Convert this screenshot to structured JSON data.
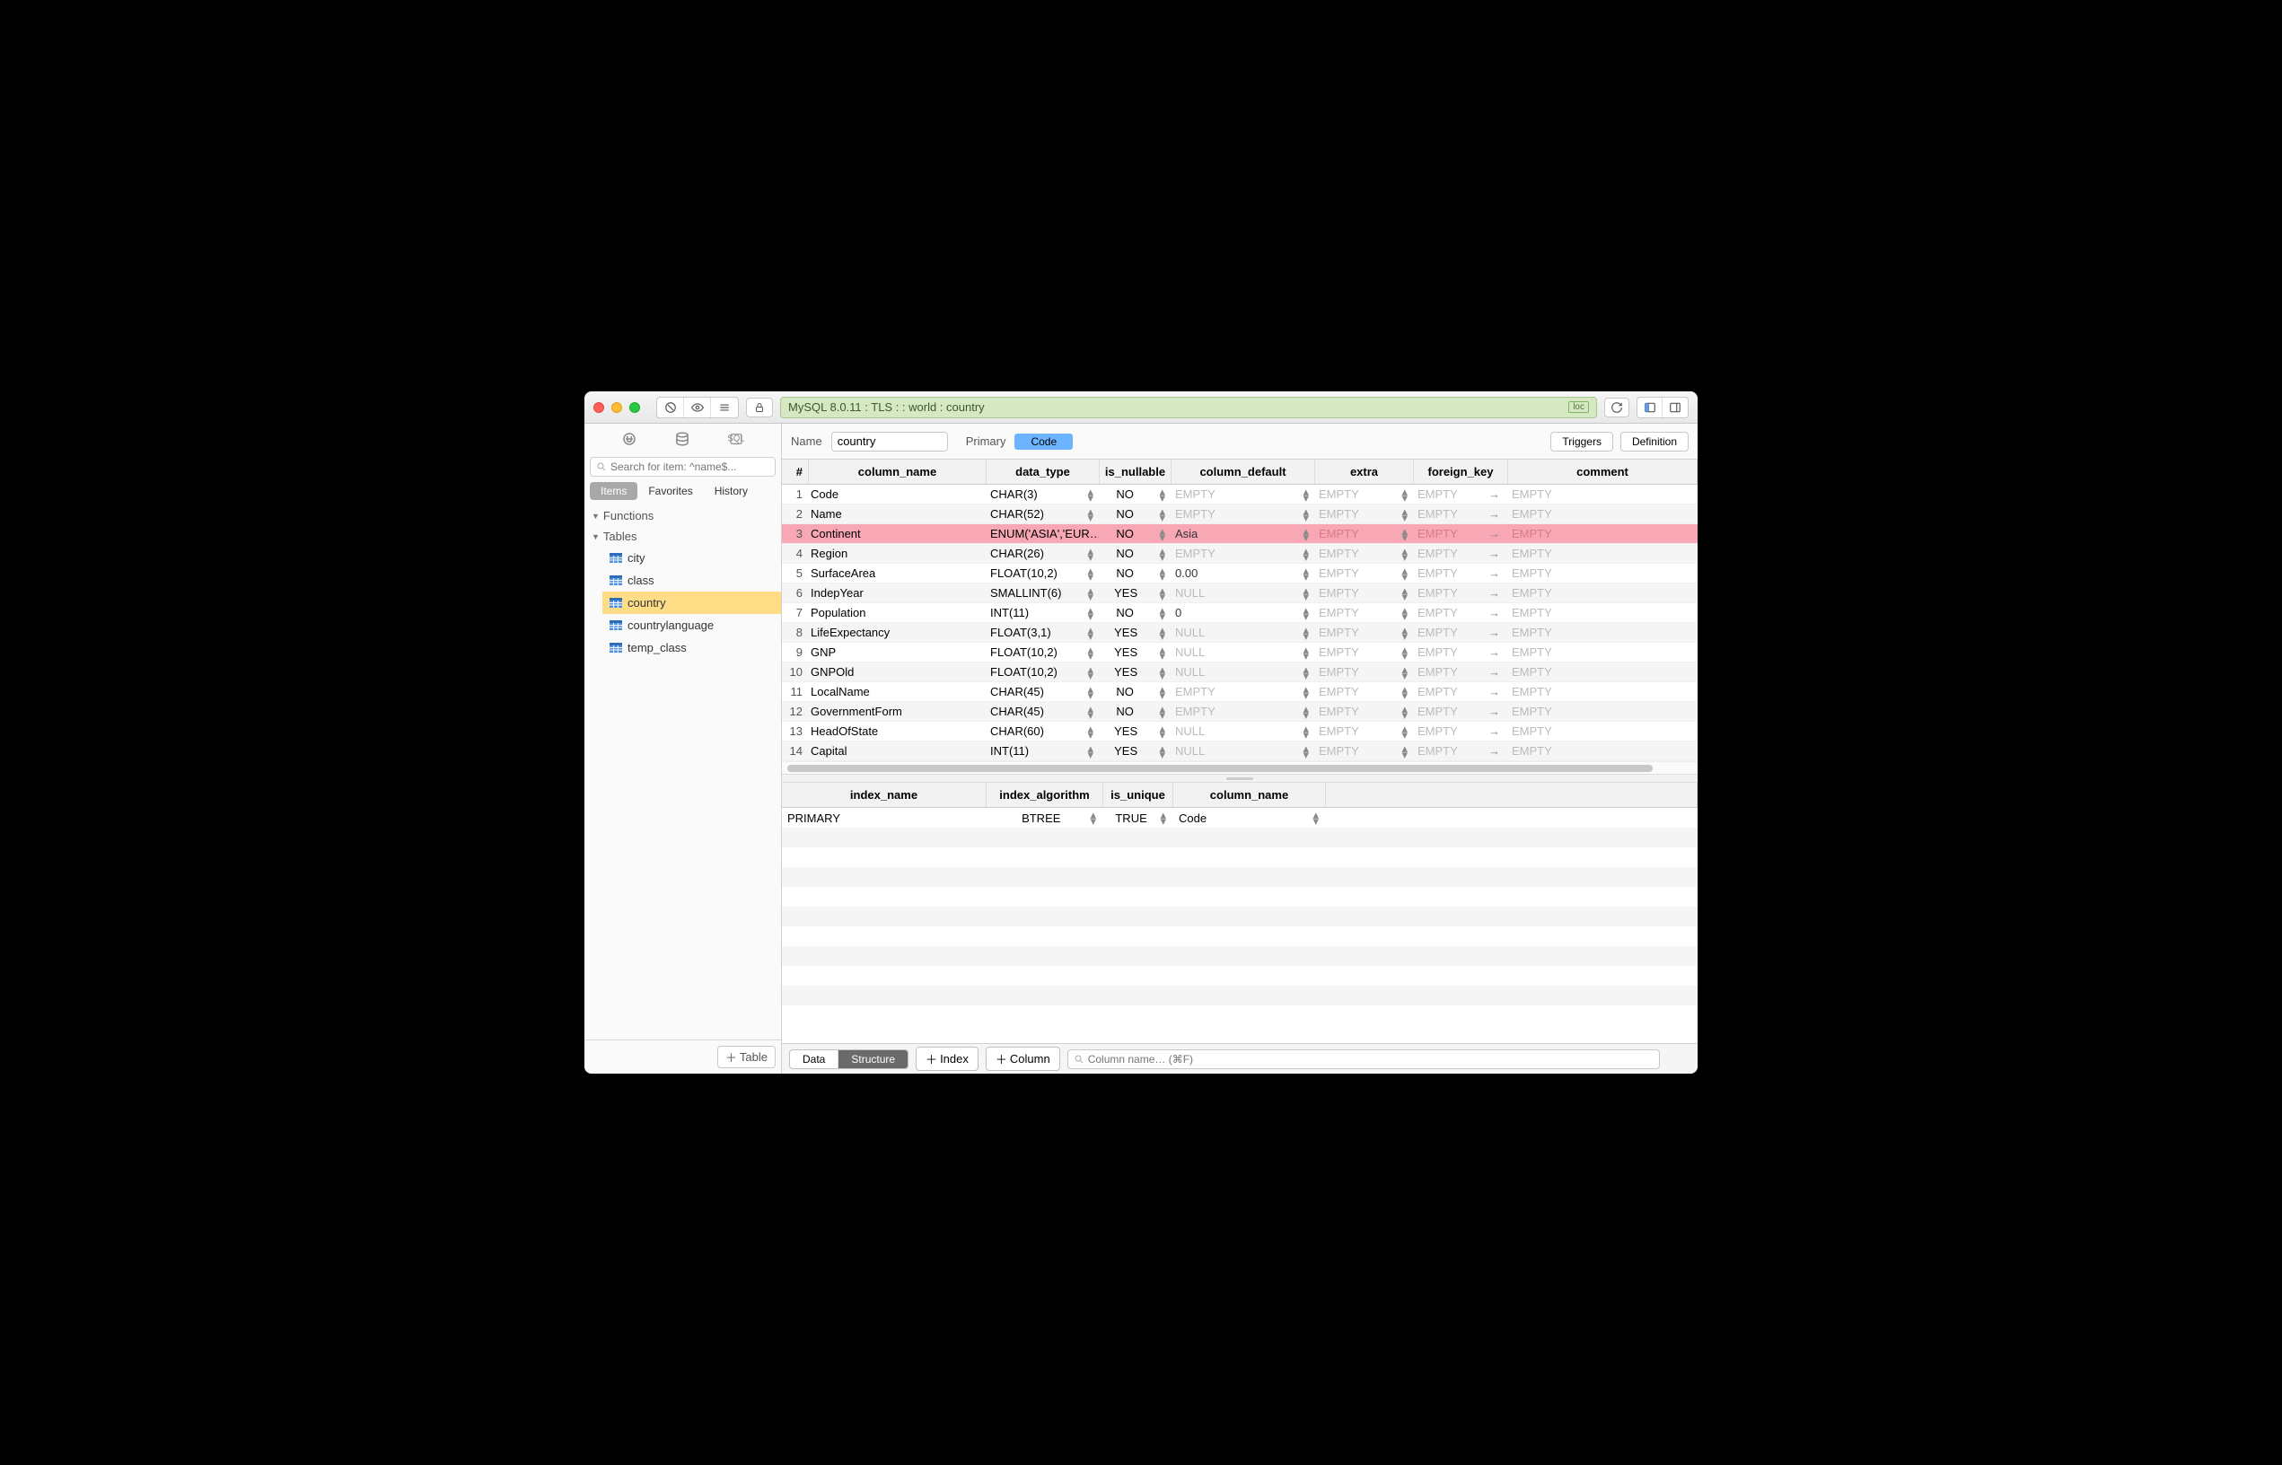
{
  "titlebar": {
    "connection": "MySQL 8.0.11 : TLS :  : world : country",
    "loc_badge": "loc"
  },
  "sidebar": {
    "search_placeholder": "Search for item: ^name$...",
    "tabs": {
      "items": "Items",
      "favorites": "Favorites",
      "history": "History"
    },
    "sections": {
      "functions": "Functions",
      "tables": "Tables"
    },
    "tables": [
      "city",
      "class",
      "country",
      "countrylanguage",
      "temp_class"
    ],
    "selected_table": "country",
    "add_table": "Table"
  },
  "header": {
    "name_label": "Name",
    "name_value": "country",
    "primary_label": "Primary",
    "primary_value": "Code",
    "triggers": "Triggers",
    "definition": "Definition"
  },
  "columns_grid": {
    "headers": {
      "idx": "#",
      "name": "column_name",
      "type": "data_type",
      "null": "is_nullable",
      "def": "column_default",
      "extra": "extra",
      "fk": "foreign_key",
      "comm": "comment"
    },
    "empty_text": "EMPTY",
    "rows": [
      {
        "idx": 1,
        "name": "Code",
        "type": "CHAR(3)",
        "null": "NO",
        "def": "EMPTY",
        "extra": "EMPTY",
        "fk": "EMPTY",
        "comm": "EMPTY"
      },
      {
        "idx": 2,
        "name": "Name",
        "type": "CHAR(52)",
        "null": "NO",
        "def": "EMPTY",
        "extra": "EMPTY",
        "fk": "EMPTY",
        "comm": "EMPTY"
      },
      {
        "idx": 3,
        "name": "Continent",
        "type": "ENUM('ASIA','EUR…",
        "null": "NO",
        "def": "Asia",
        "extra": "EMPTY",
        "fk": "EMPTY",
        "comm": "EMPTY",
        "selected": true
      },
      {
        "idx": 4,
        "name": "Region",
        "type": "CHAR(26)",
        "null": "NO",
        "def": "EMPTY",
        "extra": "EMPTY",
        "fk": "EMPTY",
        "comm": "EMPTY"
      },
      {
        "idx": 5,
        "name": "SurfaceArea",
        "type": "FLOAT(10,2)",
        "null": "NO",
        "def": "0.00",
        "extra": "EMPTY",
        "fk": "EMPTY",
        "comm": "EMPTY"
      },
      {
        "idx": 6,
        "name": "IndepYear",
        "type": "SMALLINT(6)",
        "null": "YES",
        "def": "NULL",
        "extra": "EMPTY",
        "fk": "EMPTY",
        "comm": "EMPTY"
      },
      {
        "idx": 7,
        "name": "Population",
        "type": "INT(11)",
        "null": "NO",
        "def": "0",
        "extra": "EMPTY",
        "fk": "EMPTY",
        "comm": "EMPTY"
      },
      {
        "idx": 8,
        "name": "LifeExpectancy",
        "type": "FLOAT(3,1)",
        "null": "YES",
        "def": "NULL",
        "extra": "EMPTY",
        "fk": "EMPTY",
        "comm": "EMPTY"
      },
      {
        "idx": 9,
        "name": "GNP",
        "type": "FLOAT(10,2)",
        "null": "YES",
        "def": "NULL",
        "extra": "EMPTY",
        "fk": "EMPTY",
        "comm": "EMPTY"
      },
      {
        "idx": 10,
        "name": "GNPOld",
        "type": "FLOAT(10,2)",
        "null": "YES",
        "def": "NULL",
        "extra": "EMPTY",
        "fk": "EMPTY",
        "comm": "EMPTY"
      },
      {
        "idx": 11,
        "name": "LocalName",
        "type": "CHAR(45)",
        "null": "NO",
        "def": "EMPTY",
        "extra": "EMPTY",
        "fk": "EMPTY",
        "comm": "EMPTY"
      },
      {
        "idx": 12,
        "name": "GovernmentForm",
        "type": "CHAR(45)",
        "null": "NO",
        "def": "EMPTY",
        "extra": "EMPTY",
        "fk": "EMPTY",
        "comm": "EMPTY"
      },
      {
        "idx": 13,
        "name": "HeadOfState",
        "type": "CHAR(60)",
        "null": "YES",
        "def": "NULL",
        "extra": "EMPTY",
        "fk": "EMPTY",
        "comm": "EMPTY"
      },
      {
        "idx": 14,
        "name": "Capital",
        "type": "INT(11)",
        "null": "YES",
        "def": "NULL",
        "extra": "EMPTY",
        "fk": "EMPTY",
        "comm": "EMPTY"
      }
    ]
  },
  "indexes_grid": {
    "headers": {
      "name": "index_name",
      "alg": "index_algorithm",
      "uniq": "is_unique",
      "col": "column_name"
    },
    "rows": [
      {
        "name": "PRIMARY",
        "alg": "BTREE",
        "uniq": "TRUE",
        "col": "Code"
      }
    ]
  },
  "bottombar": {
    "data": "Data",
    "structure": "Structure",
    "add_index": "Index",
    "add_column": "Column",
    "search_placeholder": "Column name… (⌘F)"
  }
}
